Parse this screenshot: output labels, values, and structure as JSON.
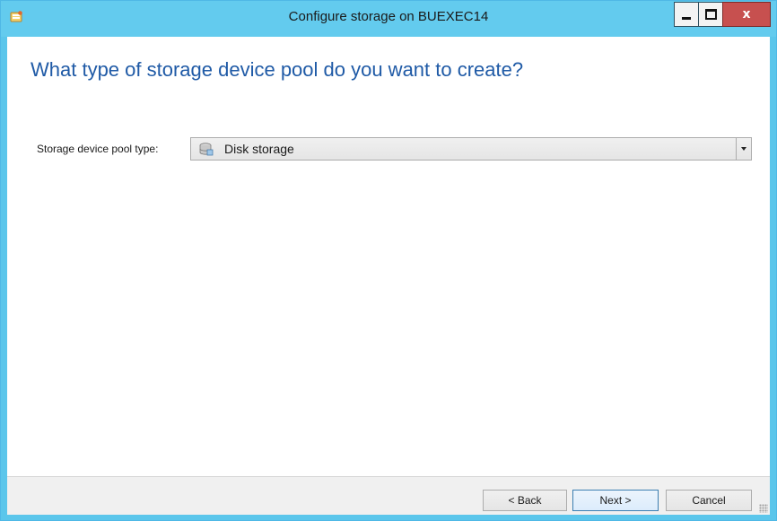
{
  "window": {
    "title": "Configure storage on BUEXEC14",
    "app_icon": "storage-wizard-icon",
    "controls": {
      "minimize": "minimize-icon",
      "maximize": "maximize-icon",
      "close": "close-icon",
      "close_glyph": "x"
    }
  },
  "page": {
    "heading": "What type of storage device pool do you want to create?"
  },
  "form": {
    "pool_type_label": "Storage device pool type:",
    "pool_type_value": "Disk storage",
    "pool_type_icon": "disk-storage-icon"
  },
  "footer": {
    "back_label": "< Back",
    "next_label": "Next >",
    "cancel_label": "Cancel"
  },
  "colors": {
    "titlebar": "#63cbee",
    "heading": "#1f5aa6",
    "close_button": "#c7504f"
  }
}
